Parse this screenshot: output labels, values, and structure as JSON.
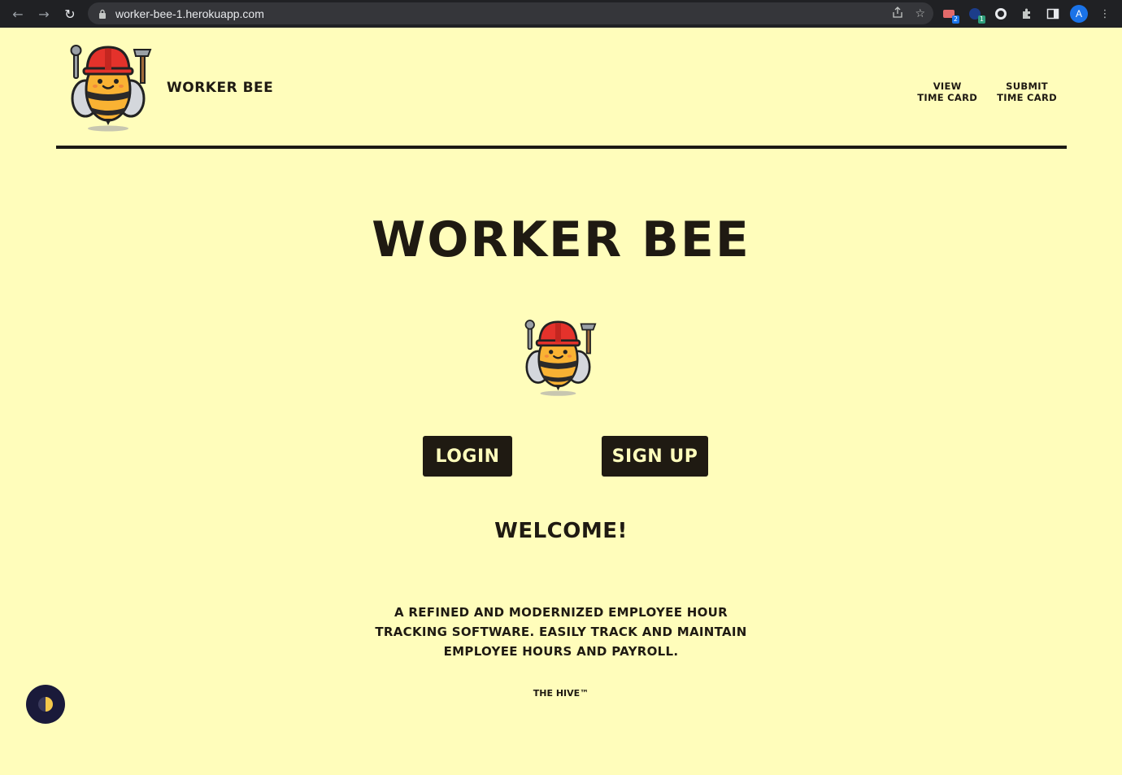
{
  "browser": {
    "url": "worker-bee-1.herokuapp.com",
    "ext_badges": [
      "2",
      "1"
    ],
    "profile_initial": "A"
  },
  "header": {
    "brand": "WORKER BEE",
    "nav": {
      "view_line1": "View",
      "view_line2": "Time Card",
      "submit_line1": "Submit",
      "submit_line2": "Time Card"
    }
  },
  "hero": {
    "title": "WORKER BEE"
  },
  "buttons": {
    "login": "Login",
    "signup": "Sign Up"
  },
  "welcome": "Welcome!",
  "tagline": "A refined and modernized employee hour tracking software. Easily track and maintain employee hours and payroll.",
  "footer_note": "The Hive™",
  "colors": {
    "background": "#fffdbb",
    "text": "#1f1a12",
    "button_bg": "#1f1a12",
    "button_text": "#fffdbb",
    "helmet": "#e4322b",
    "bee_body": "#f9b233"
  },
  "icons": {
    "back": "back-arrow-icon",
    "forward": "forward-arrow-icon",
    "reload": "reload-icon",
    "lock": "lock-icon",
    "share": "share-icon",
    "bookmark": "star-icon",
    "extensions": "puzzle-icon",
    "sidepanel": "side-panel-icon",
    "menu": "kebab-menu-icon",
    "dark_mode": "half-moon-icon",
    "logo": "worker-bee-logo"
  }
}
